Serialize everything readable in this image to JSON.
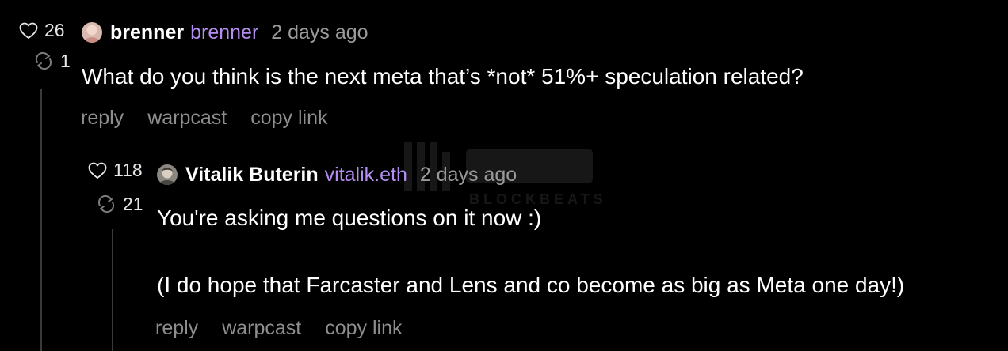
{
  "casts": [
    {
      "likes": "26",
      "recasts": "1",
      "display_name": "brenner",
      "username": "brenner",
      "timestamp": "2 days ago",
      "text": "What do you think is the next meta that’s *not* 51%+ speculation related?",
      "actions": {
        "reply": "reply",
        "warpcast": "warpcast",
        "copy_link": "copy link"
      }
    },
    {
      "likes": "118",
      "recasts": "21",
      "display_name": "Vitalik Buterin",
      "username": "vitalik.eth",
      "timestamp": "2 days ago",
      "text_lines": [
        "You're asking me questions on it now :)",
        "(I do hope that Farcaster and Lens and co become as big as Meta one day!)"
      ],
      "actions": {
        "reply": "reply",
        "warpcast": "warpcast",
        "copy_link": "copy link"
      }
    }
  ],
  "watermark": {
    "text": "BLOCKBEATS"
  },
  "colors": {
    "background": "#000000",
    "username": "#b48ef2",
    "muted": "#9a9a9a",
    "actions": "#8e8e8e",
    "thread_line": "#3a3a3a"
  },
  "icons": {
    "like": "heart-icon",
    "recast": "recast-icon"
  }
}
